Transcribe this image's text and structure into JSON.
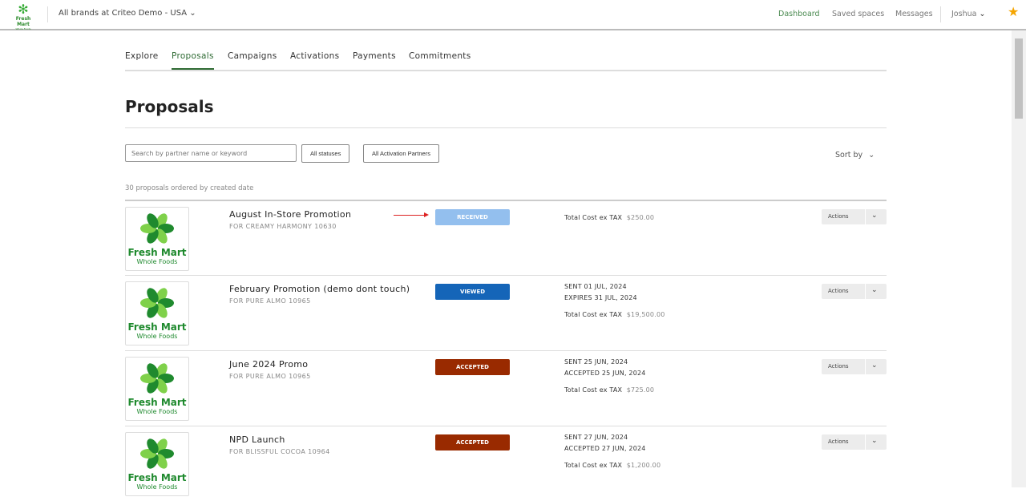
{
  "header": {
    "logo_text": "Fresh Mart",
    "logo_sub": "Whole Foods",
    "brand_selector": "All brands at Criteo Demo - USA",
    "nav": [
      "Dashboard",
      "Saved spaces",
      "Messages"
    ],
    "user": "Joshua"
  },
  "tabs": [
    "Explore",
    "Proposals",
    "Campaigns",
    "Activations",
    "Payments",
    "Commitments"
  ],
  "page_title": "Proposals",
  "filters": {
    "search_placeholder": "Search by partner name or keyword",
    "statuses": "All statuses",
    "partners": "All Activation Partners",
    "sort": "Sort by"
  },
  "count_text": "30 proposals ordered by created date",
  "cost_label": "Total Cost ex TAX",
  "actions_label": "Actions",
  "proposals": [
    {
      "title": "August In-Store Promotion",
      "for": "FOR CREAMY HARMONY 10630",
      "status": "RECEIVED",
      "status_color": "#93bfee",
      "lines": [],
      "cost": "$250.00"
    },
    {
      "title": "February Promotion (demo dont touch)",
      "for": "FOR PURE ALMO 10965",
      "status": "VIEWED",
      "status_color": "#1565b8",
      "lines": [
        "SENT 01 JUL, 2024",
        "EXPIRES 31 JUL, 2024"
      ],
      "cost": "$19,500.00"
    },
    {
      "title": "June 2024 Promo",
      "for": "FOR PURE ALMO 10965",
      "status": "ACCEPTED",
      "status_color": "#992a00",
      "lines": [
        "SENT 25 JUN, 2024",
        "ACCEPTED 25 JUN, 2024"
      ],
      "cost": "$725.00"
    },
    {
      "title": "NPD Launch",
      "for": "FOR BLISSFUL COCOA 10964",
      "status": "ACCEPTED",
      "status_color": "#992a00",
      "lines": [
        "SENT 27 JUN, 2024",
        "ACCEPTED 27 JUN, 2024"
      ],
      "cost": "$1,200.00"
    }
  ]
}
